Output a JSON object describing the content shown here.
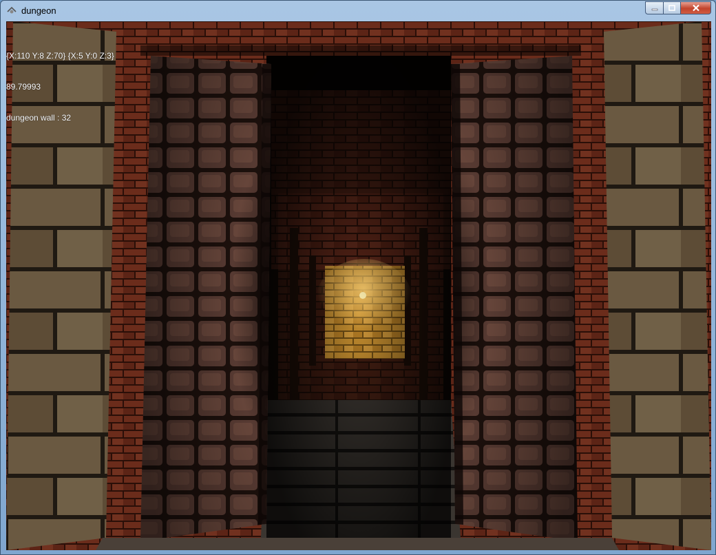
{
  "window": {
    "title": "dungeon",
    "buttons": {
      "minimize": "minimize-icon",
      "maximize": "maximize-icon",
      "close": "close-icon"
    }
  },
  "hud": {
    "coordinates": "{X:110 Y:8 Z:70} {X:5 Y:0 Z:3}",
    "angle": "89.79993",
    "target": "dungeon wall : 32"
  },
  "colors": {
    "brick": "#5a2a1c",
    "stone": "#8b7355",
    "door": "#3a2420",
    "torch_glow": "#c88a28"
  }
}
